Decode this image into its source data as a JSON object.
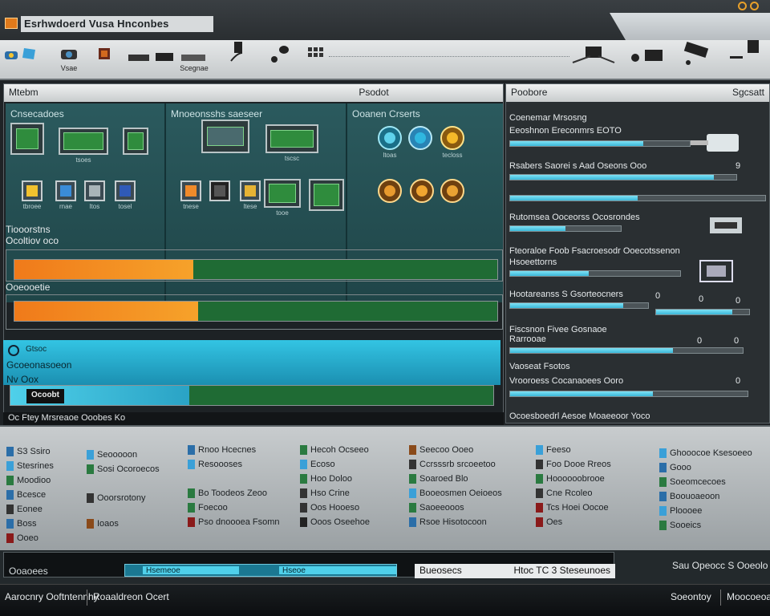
{
  "window": {
    "title": "Esrhwdoerd Vusa Hnconbes"
  },
  "toolbar": {
    "labels": [
      "Vsae",
      "Scegnae"
    ]
  },
  "left_panel": {
    "title_left": "Mtebm",
    "title_center": "Psodot",
    "zones": {
      "z1": "Cnsecadoes",
      "z2": "Mnoeonsshs saeseer",
      "z3": "Ooanen Crserts"
    },
    "device_labels": [
      "tsoes",
      "tbroee",
      "rnae",
      "ltos",
      "tosel",
      "tscsc",
      "tnese",
      "ltese",
      "tooe",
      "ltoas",
      "tecloss"
    ],
    "section1_title": "Tiooorstns",
    "section1_sub": "Ocoltiov oco",
    "bar1_fill": 0.37,
    "section2_title": "Ooeooetie",
    "bar2_fill": 0.38,
    "g_title": "Gcoeonasoeon",
    "g_subtitle": "Gtsoc",
    "g_prefix": "Nv Oox",
    "g_tag": "Ocoobt",
    "g_bar_fill": 0.37,
    "footer": "Oc Ftey Mrsreaoe Ooobes Ko"
  },
  "right_panel": {
    "title_left": "Poobore",
    "title_right": "Sgcsatt",
    "rows": [
      {
        "label": "Coenemar Mrsosng",
        "fill": 0.7
      },
      {
        "label": "Eeoshnon Ereconmrs EOTO",
        "fill": 0.74
      },
      {
        "label": "Rsabers Saorei s Aad Oseons Ooo",
        "fill": 0.9,
        "num": "9"
      },
      {
        "label": "Rutomsea Ooceorss Ocosrondes",
        "fill": 0.5
      },
      {
        "label": "Fteoraloe Foob Fsacroesodr Ooecotssenon",
        "fill": 0.46
      },
      {
        "label": "Hsoeettorns",
        "fill": 0.56
      },
      {
        "label": "Hootareanss S Gsorteocners",
        "fill": 0.82,
        "num_a": "0",
        "num_b": "0"
      },
      {
        "label": "Fiscsnon Fivee Gosnaoe",
        "fill": 0.76,
        "num_a": "0",
        "num_b": "0"
      },
      {
        "label": "Rarrooae",
        "fill": 0.7
      },
      {
        "label": "Vaoseat Fsotos",
        "fill": 0.64
      },
      {
        "label": "Vrooroess Cocanaoees Ooro",
        "fill": 0.6,
        "num": "0"
      }
    ],
    "footer": "Ocoesboedrl Aesoe Moaeeoor Yoco"
  },
  "bottom": {
    "columns": [
      [
        "S3 Ssiro",
        "Stesrines",
        "Moodioo",
        "Bcesce",
        "Eonee",
        "Boss",
        "Ooeo"
      ],
      [
        "Seooooon",
        "Sosi Ocoroecos",
        "Ooorsrotony",
        "Ioaos"
      ],
      [
        "Rnoo Hcecnes",
        "Resoooses",
        "Bo Toodeos Zeoo",
        "Foecoo",
        "Pso dnoooea Fsomn"
      ],
      [
        "Hecoh Ocseeo",
        "Ecoso",
        "Hoo Doloo",
        "Hso Crine",
        "Oos Hooeso",
        "Ooos Oseehoe"
      ],
      [
        "Seecoo Ooeo",
        "Ccrsssrb srcoeetoo",
        "Soaroed Blo",
        "Booeosmen Oeioeos",
        "Saoeeooos",
        "Rsoe Hisotocoon"
      ],
      [
        "Feeso",
        "Foo Dooe Rreos",
        "Hoooooobrooe",
        "Cne Rcoleo",
        "Tcs Hoei Oocoe",
        "Oes"
      ],
      [
        "Ghooocoe Ksesoeeo",
        "Gooo",
        "Soeomcecoes",
        "Boouoaeoon",
        "Ploooee",
        "Sooeics"
      ]
    ]
  },
  "status": {
    "left_label": "Ooaoees",
    "seg1": "Hsemeoe",
    "seg2": "Hseoe",
    "progress": 0.98,
    "right_a": "Bueosecs",
    "right_b": "Htoc TC 3 Steseunoes",
    "far": "Sau Opeocc S Ooeolo"
  },
  "taskbar": {
    "left": "Aarocnry Ooftntennhy",
    "mid": "Roaaldreon Ocert",
    "right1": "Soeontoy",
    "right2": "Moocoeoae"
  }
}
